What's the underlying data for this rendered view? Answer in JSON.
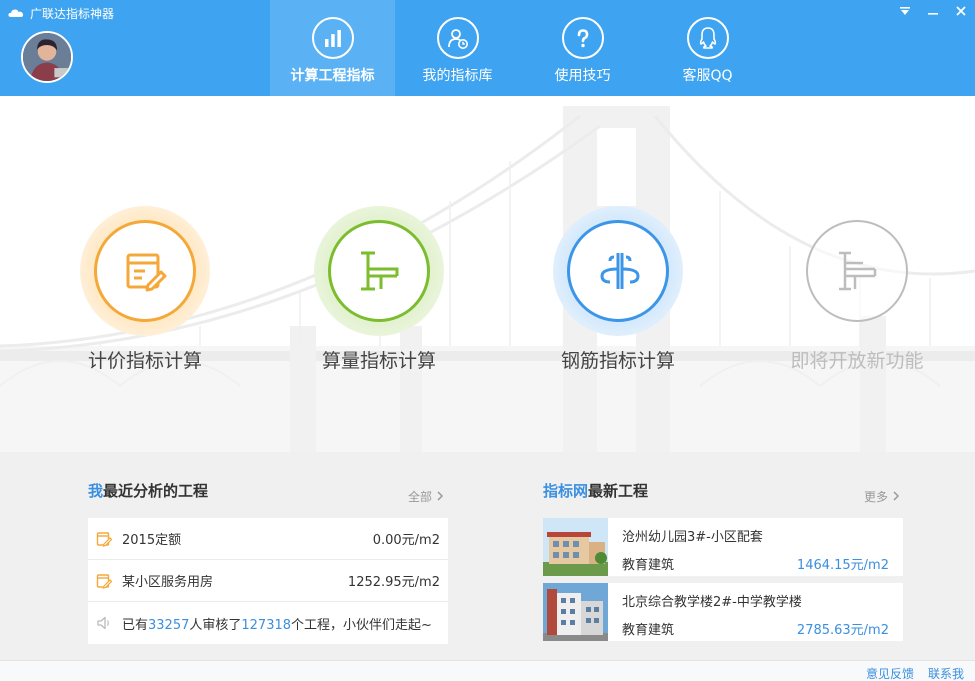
{
  "app": {
    "title": "广联达指标神器"
  },
  "nav": [
    {
      "label": "计算工程指标",
      "icon": "bar-chart-icon"
    },
    {
      "label": "我的指标库",
      "icon": "user-clock-icon"
    },
    {
      "label": "使用技巧",
      "icon": "question-icon"
    },
    {
      "label": "客服QQ",
      "icon": "qq-icon"
    }
  ],
  "features": [
    {
      "label": "计价指标计算",
      "icon": "document-pencil-icon",
      "color": "#f5a83a"
    },
    {
      "label": "算量指标计算",
      "icon": "beam-icon",
      "color": "#7cbd2e"
    },
    {
      "label": "钢筋指标计算",
      "icon": "rebar-icon",
      "color": "#3b95e8"
    },
    {
      "label": "即将开放新功能",
      "icon": "beam-stack-icon",
      "color": "#bdbdbd"
    }
  ],
  "recent": {
    "title_accent": "我",
    "title_rest": "最近分析的工程",
    "more": "全部",
    "items": [
      {
        "name": "2015定额",
        "value": "0.00元/m2"
      },
      {
        "name": "某小区服务用房",
        "value": "1252.95元/m2"
      }
    ],
    "note": {
      "prefix": "已有",
      "users": "33257",
      "middle": "人审核了",
      "projects": "127318",
      "suffix": "个工程，小伙伴们走起~"
    }
  },
  "latest": {
    "title_accent": "指标网",
    "title_rest": "最新工程",
    "more": "更多",
    "items": [
      {
        "title": "沧州幼儿园3#-小区配套",
        "type": "教育建筑",
        "price": "1464.15元/m2"
      },
      {
        "title": "北京综合教学楼2#-中学教学楼",
        "type": "教育建筑",
        "price": "2785.63元/m2"
      }
    ]
  },
  "footer": {
    "feedback": "意见反馈",
    "contact": "联系我们"
  },
  "colors": {
    "header": "#3ea3f0",
    "accent": "#3a8fe0"
  }
}
